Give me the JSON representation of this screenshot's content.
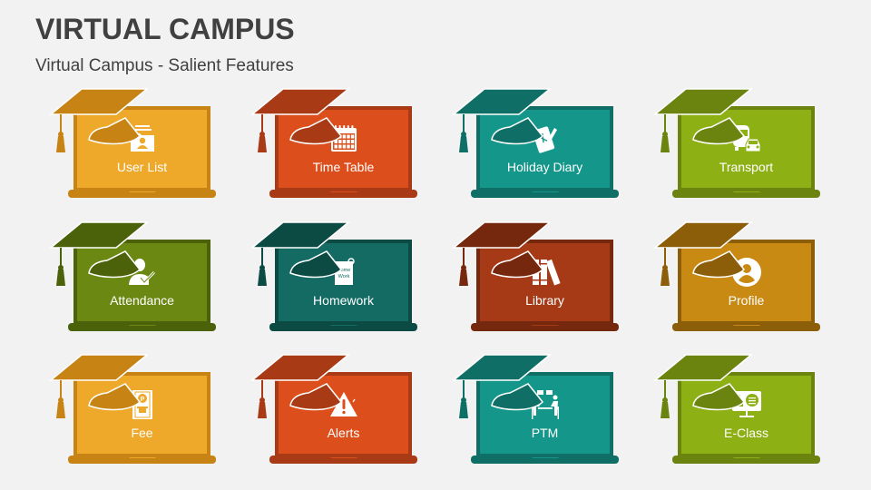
{
  "header": {
    "title": "VIRTUAL CAMPUS",
    "subtitle": "Virtual Campus - Salient Features"
  },
  "features": [
    {
      "label": "User List",
      "icon": "user-folder-icon",
      "main": "#eea82a",
      "dark": "#c78414"
    },
    {
      "label": "Time Table",
      "icon": "calendar-icon",
      "main": "#dc4f1c",
      "dark": "#a83a16"
    },
    {
      "label": "Holiday Diary",
      "icon": "diary-icon",
      "main": "#14978a",
      "dark": "#0f6f66"
    },
    {
      "label": "Transport",
      "icon": "bus-car-icon",
      "main": "#8db015",
      "dark": "#6a840f"
    },
    {
      "label": "Attendance",
      "icon": "user-check-icon",
      "main": "#6b8912",
      "dark": "#4b620b"
    },
    {
      "label": "Homework",
      "icon": "homework-note-icon",
      "main": "#136b63",
      "dark": "#0c4a44"
    },
    {
      "label": "Library",
      "icon": "books-icon",
      "main": "#a63a16",
      "dark": "#76280e"
    },
    {
      "label": "Profile",
      "icon": "profile-icon",
      "main": "#c98a14",
      "dark": "#8c5e0a"
    },
    {
      "label": "Fee",
      "icon": "payment-icon",
      "main": "#eea82a",
      "dark": "#c78414"
    },
    {
      "label": "Alerts",
      "icon": "warning-icon",
      "main": "#dc4f1c",
      "dark": "#a83a16"
    },
    {
      "label": "PTM",
      "icon": "meeting-icon",
      "main": "#14978a",
      "dark": "#0f6f66"
    },
    {
      "label": "E-Class",
      "icon": "eclass-icon",
      "main": "#8db015",
      "dark": "#6a840f"
    }
  ],
  "homework_icon_text": [
    "Home",
    "Work"
  ]
}
